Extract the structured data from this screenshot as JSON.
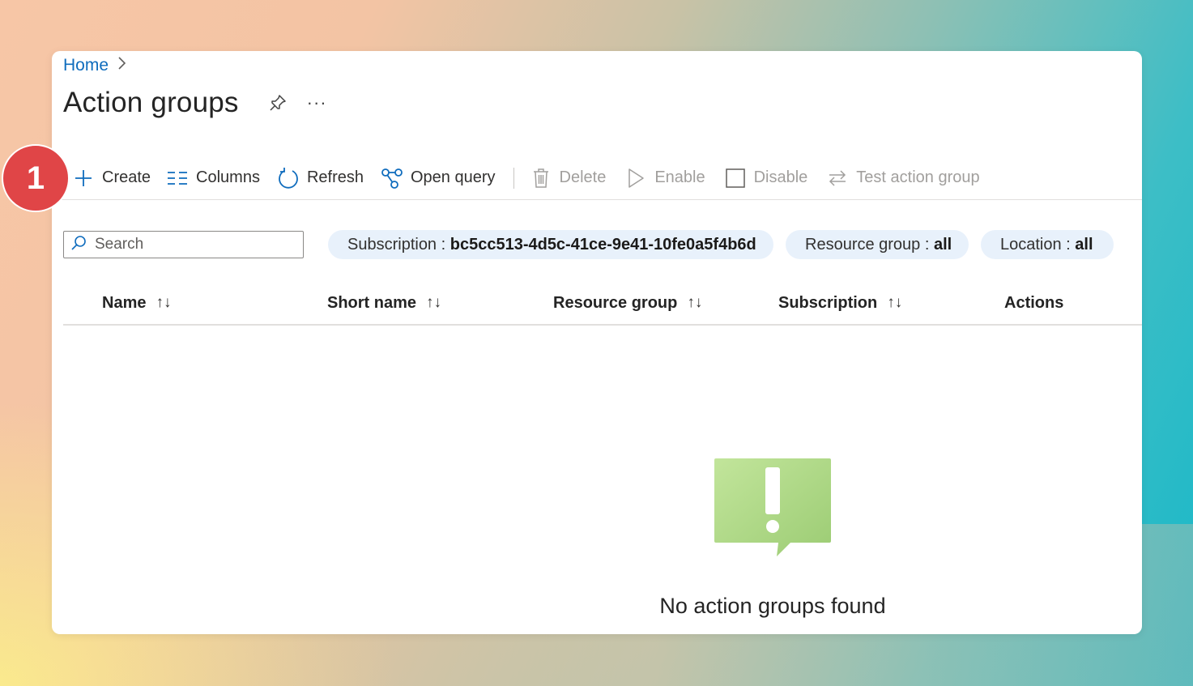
{
  "breadcrumb": {
    "home": "Home",
    "separator": "›"
  },
  "page": {
    "title": "Action groups",
    "more": "···"
  },
  "toolbar": {
    "create": "Create",
    "columns": "Columns",
    "refresh": "Refresh",
    "open_query": "Open query",
    "delete": "Delete",
    "enable": "Enable",
    "disable": "Disable",
    "test_action_group": "Test action group"
  },
  "search": {
    "placeholder": "Search"
  },
  "filters": {
    "subscription": {
      "label": "Subscription : ",
      "value": "bc5cc513-4d5c-41ce-9e41-10fe0a5f4b6d"
    },
    "resource_group": {
      "label": "Resource group : ",
      "value": "all"
    },
    "location": {
      "label": "Location : ",
      "value": "all"
    }
  },
  "table": {
    "columns": [
      {
        "label": "Name",
        "sortable": true
      },
      {
        "label": "Short name",
        "sortable": true
      },
      {
        "label": "Resource group",
        "sortable": true
      },
      {
        "label": "Subscription",
        "sortable": true
      },
      {
        "label": "Actions",
        "sortable": false
      }
    ],
    "sort_glyph": "↑↓"
  },
  "empty_state": {
    "message": "No action groups found"
  },
  "annotation": {
    "step": "1"
  },
  "colors": {
    "accent": "#0f6cbd",
    "badge": "#e04547",
    "pill_bg": "#e8f1fb",
    "empty_icon": "#a7d07e"
  },
  "icons": {
    "create": "plus-icon",
    "columns": "columns-icon",
    "refresh": "refresh-icon",
    "open_query": "query-icon",
    "delete": "trash-icon",
    "enable": "play-icon",
    "disable": "checkbox-icon",
    "test": "swap-icon",
    "pin": "pin-icon",
    "search": "search-icon",
    "empty": "warning-chat-icon"
  }
}
